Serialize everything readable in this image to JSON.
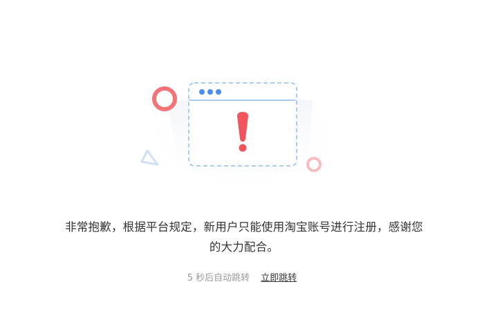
{
  "illustration": {
    "icons": [
      "browser-window-icon",
      "exclamation-icon",
      "ring-icon",
      "triangle-icon"
    ],
    "colors": {
      "window_border": "#a8cdf5",
      "window_dots": "#4a8ef2",
      "exclamation": "#f0555d",
      "ring_large": "#f27478",
      "ring_small": "#f8bcc0",
      "triangle": "#cfe0f5",
      "card_bg": "#f2f3f5"
    }
  },
  "message": {
    "text": "非常抱歉，根据平台规定，新用户只能使用淘宝账号进行注册，感谢您的大力配合。"
  },
  "countdown": {
    "text": "5 秒后自动跳转",
    "link_label": "立即跳转"
  }
}
